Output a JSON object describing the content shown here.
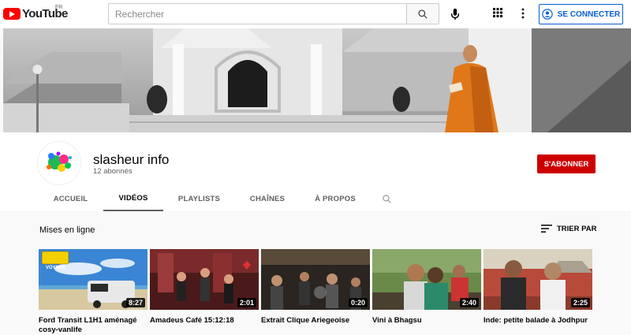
{
  "header": {
    "logo_text": "YouTube",
    "country": "FR",
    "search_placeholder": "Rechercher",
    "signin_label": "SE CONNECTER",
    "accent": "#ff0000",
    "link_color": "#065fd4"
  },
  "channel": {
    "name": "slasheur info",
    "subscribers": "12 abonnés",
    "subscribe_label": "S'ABONNER"
  },
  "tabs": [
    {
      "label": "ACCUEIL",
      "active": false
    },
    {
      "label": "VIDÉOS",
      "active": true
    },
    {
      "label": "PLAYLISTS",
      "active": false
    },
    {
      "label": "CHAÎNES",
      "active": false
    },
    {
      "label": "À PROPOS",
      "active": false
    }
  ],
  "section": {
    "title": "Mises en ligne",
    "sort_label": "TRIER PAR"
  },
  "videos": [
    {
      "title": "Ford Transit L1H1 aménagé cosy-vanlife",
      "duration": "8:27",
      "badge": "VOYAGE"
    },
    {
      "title": "Amadeus Café 15:12:18",
      "duration": "2:01"
    },
    {
      "title": "Extrait Clique Ariegeoise",
      "duration": "0:20"
    },
    {
      "title": "Vini à Bhagsu",
      "duration": "2:40"
    },
    {
      "title": "Inde: petite balade à Jodhpur",
      "duration": "2:25"
    }
  ]
}
